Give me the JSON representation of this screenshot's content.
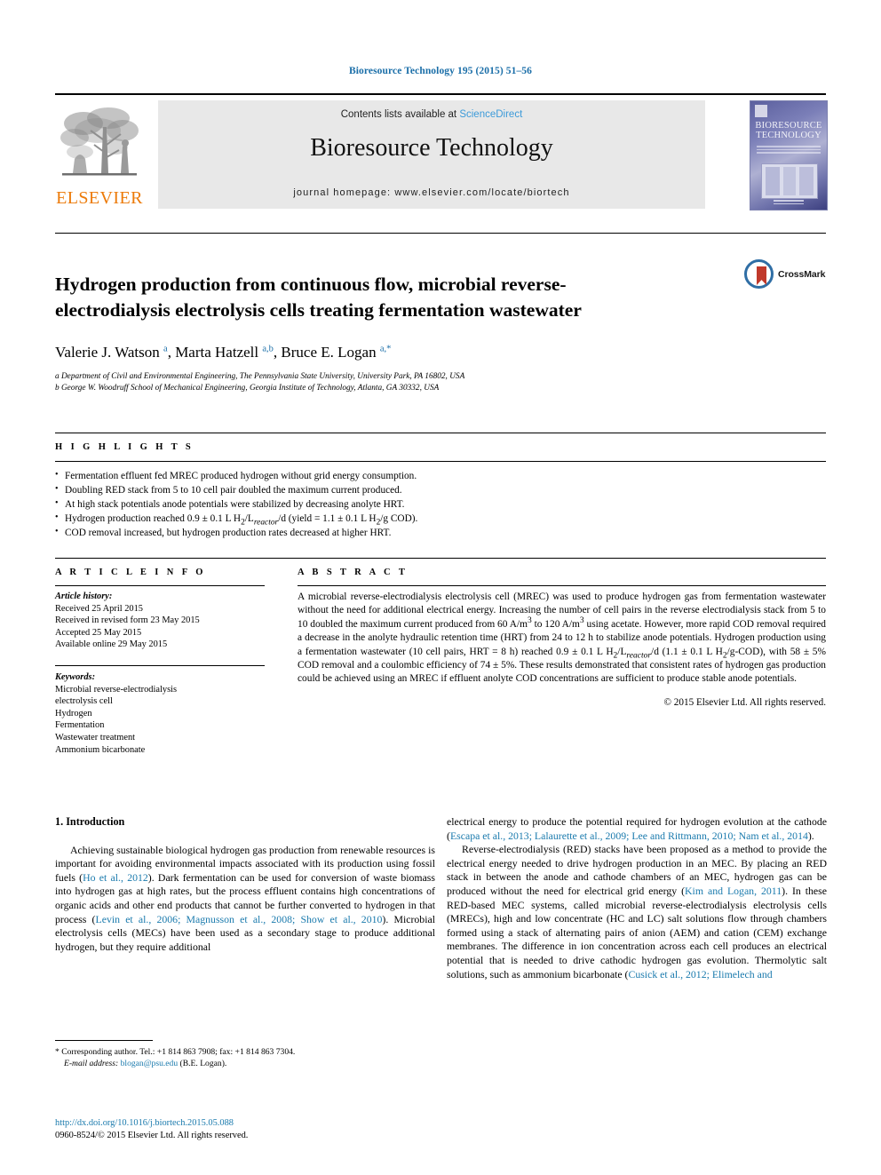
{
  "running_head": "Bioresource Technology 195 (2015) 51–56",
  "masthead": {
    "contents_prefix": "Contents lists available at",
    "sciencedirect": "ScienceDirect",
    "journal_name": "Bioresource Technology",
    "homepage": "journal homepage: www.elsevier.com/locate/biortech",
    "publisher_logo_text": "ELSEVIER",
    "cover_title_line1": "BIORESOURCE",
    "cover_title_line2": "TECHNOLOGY",
    "link_color": "#3b9ad9",
    "band_color": "#e8e8e8",
    "elsevier_orange": "#ec7a08"
  },
  "article": {
    "title": "Hydrogen production from continuous flow, microbial reverse-electrodialysis electrolysis cells treating fermentation wastewater",
    "crossmark_label": "CrossMark",
    "authors_html": "Valerie J. Watson <sup>a</sup>, Marta Hatzell <sup>a,b</sup>, Bruce E. Logan <sup>a,*</sup>",
    "affiliations": [
      "a Department of Civil and Environmental Engineering, The Pennsylvania State University, University Park, PA 16802, USA",
      "b George W. Woodruff School of Mechanical Engineering, Georgia Institute of Technology, Atlanta, GA 30332, USA"
    ]
  },
  "highlights": {
    "heading": "H I G H L I G H T S",
    "items_html": [
      "Fermentation effluent fed MREC produced hydrogen without grid energy consumption.",
      "Doubling RED stack from 5 to 10 cell pair doubled the maximum current produced.",
      "At high stack potentials anode potentials were stabilized by decreasing anolyte HRT.",
      "Hydrogen production reached 0.9 ± 0.1 L H<sub>2</sub>/L<sub><i>reactor</i></sub>/d (yield = 1.1 ± 0.1 L H<sub>2</sub>/g COD).",
      "COD removal increased, but hydrogen production rates decreased at higher HRT."
    ]
  },
  "article_info": {
    "heading": "A R T I C L E    I N F O",
    "history_label": "Article history:",
    "history": [
      "Received 25 April 2015",
      "Received in revised form 23 May 2015",
      "Accepted 25 May 2015",
      "Available online 29 May 2015"
    ],
    "keywords_label": "Keywords:",
    "keywords": [
      "Microbial reverse-electrodialysis",
      "electrolysis cell",
      "Hydrogen",
      "Fermentation",
      "Wastewater treatment",
      "Ammonium bicarbonate"
    ]
  },
  "abstract": {
    "heading": "A B S T R A C T",
    "body_html": "A microbial reverse-electrodialysis electrolysis cell (MREC) was used to produce hydrogen gas from fermentation wastewater without the need for additional electrical energy. Increasing the number of cell pairs in the reverse electrodialysis stack from 5 to 10 doubled the maximum current produced from 60 A/m<sup>3</sup> to 120 A/m<sup>3</sup> using acetate. However, more rapid COD removal required a decrease in the anolyte hydraulic retention time (HRT) from 24 to 12 h to stabilize anode potentials. Hydrogen production using a fermentation wastewater (10 cell pairs, HRT = 8 h) reached 0.9 ± 0.1 L H<sub>2</sub>/L<sub><i>reactor</i></sub>/d (1.1 ± 0.1 L H<sub>2</sub>/g-COD), with 58 ± 5% COD removal and a coulombic efficiency of 74 ± 5%. These results demonstrated that consistent rates of hydrogen gas production could be achieved using an MREC if effluent anolyte COD concentrations are sufficient to produce stable anode potentials.",
    "copyright": "© 2015 Elsevier Ltd. All rights reserved."
  },
  "introduction": {
    "heading": "1. Introduction",
    "left_p1_html": "Achieving sustainable biological hydrogen gas production from renewable resources is important for avoiding environmental impacts associated with its production using fossil fuels (<span class=\"ref\">Ho et al., 2012</span>). Dark fermentation can be used for conversion of waste biomass into hydrogen gas at high rates, but the process effluent contains high concentrations of organic acids and other end products that cannot be further converted to hydrogen in that process (<span class=\"ref\">Levin et al., 2006; Magnusson et al., 2008; Show et al., 2010</span>). Microbial electrolysis cells (MECs) have been used as a secondary stage to produce additional hydrogen, but they require additional",
    "right_p1_html": "electrical energy to produce the potential required for hydrogen evolution at the cathode (<span class=\"ref\">Escapa et al., 2013; Lalaurette et al., 2009; Lee and Rittmann, 2010; Nam et al., 2014</span>).",
    "right_p2_html": "Reverse-electrodialysis (RED) stacks have been proposed as a method to provide the electrical energy needed to drive hydrogen production in an MEC. By placing an RED stack in between the anode and cathode chambers of an MEC, hydrogen gas can be produced without the need for electrical grid energy (<span class=\"ref\">Kim and Logan, 2011</span>). In these RED-based MEC systems, called microbial reverse-electrodialysis electrolysis cells (MRECs), high and low concentrate (HC and LC) salt solutions flow through chambers formed using a stack of alternating pairs of anion (AEM) and cation (CEM) exchange membranes. The difference in ion concentration across each cell produces an electrical potential that is needed to drive cathodic hydrogen gas evolution. Thermolytic salt solutions, such as ammonium bicarbonate (<span class=\"ref\">Cusick et al., 2012; Elimelech and</span>"
  },
  "footnote": {
    "corresponding_html": "* Corresponding author. Tel.: +1 814 863 7908; fax: +1 814 863 7304.",
    "email_label": "E-mail address:",
    "email": "blogan@psu.edu",
    "email_owner": "(B.E. Logan)."
  },
  "footer": {
    "doi": "http://dx.doi.org/10.1016/j.biortech.2015.05.088",
    "issn_line": "0960-8524/© 2015 Elsevier Ltd. All rights reserved."
  }
}
